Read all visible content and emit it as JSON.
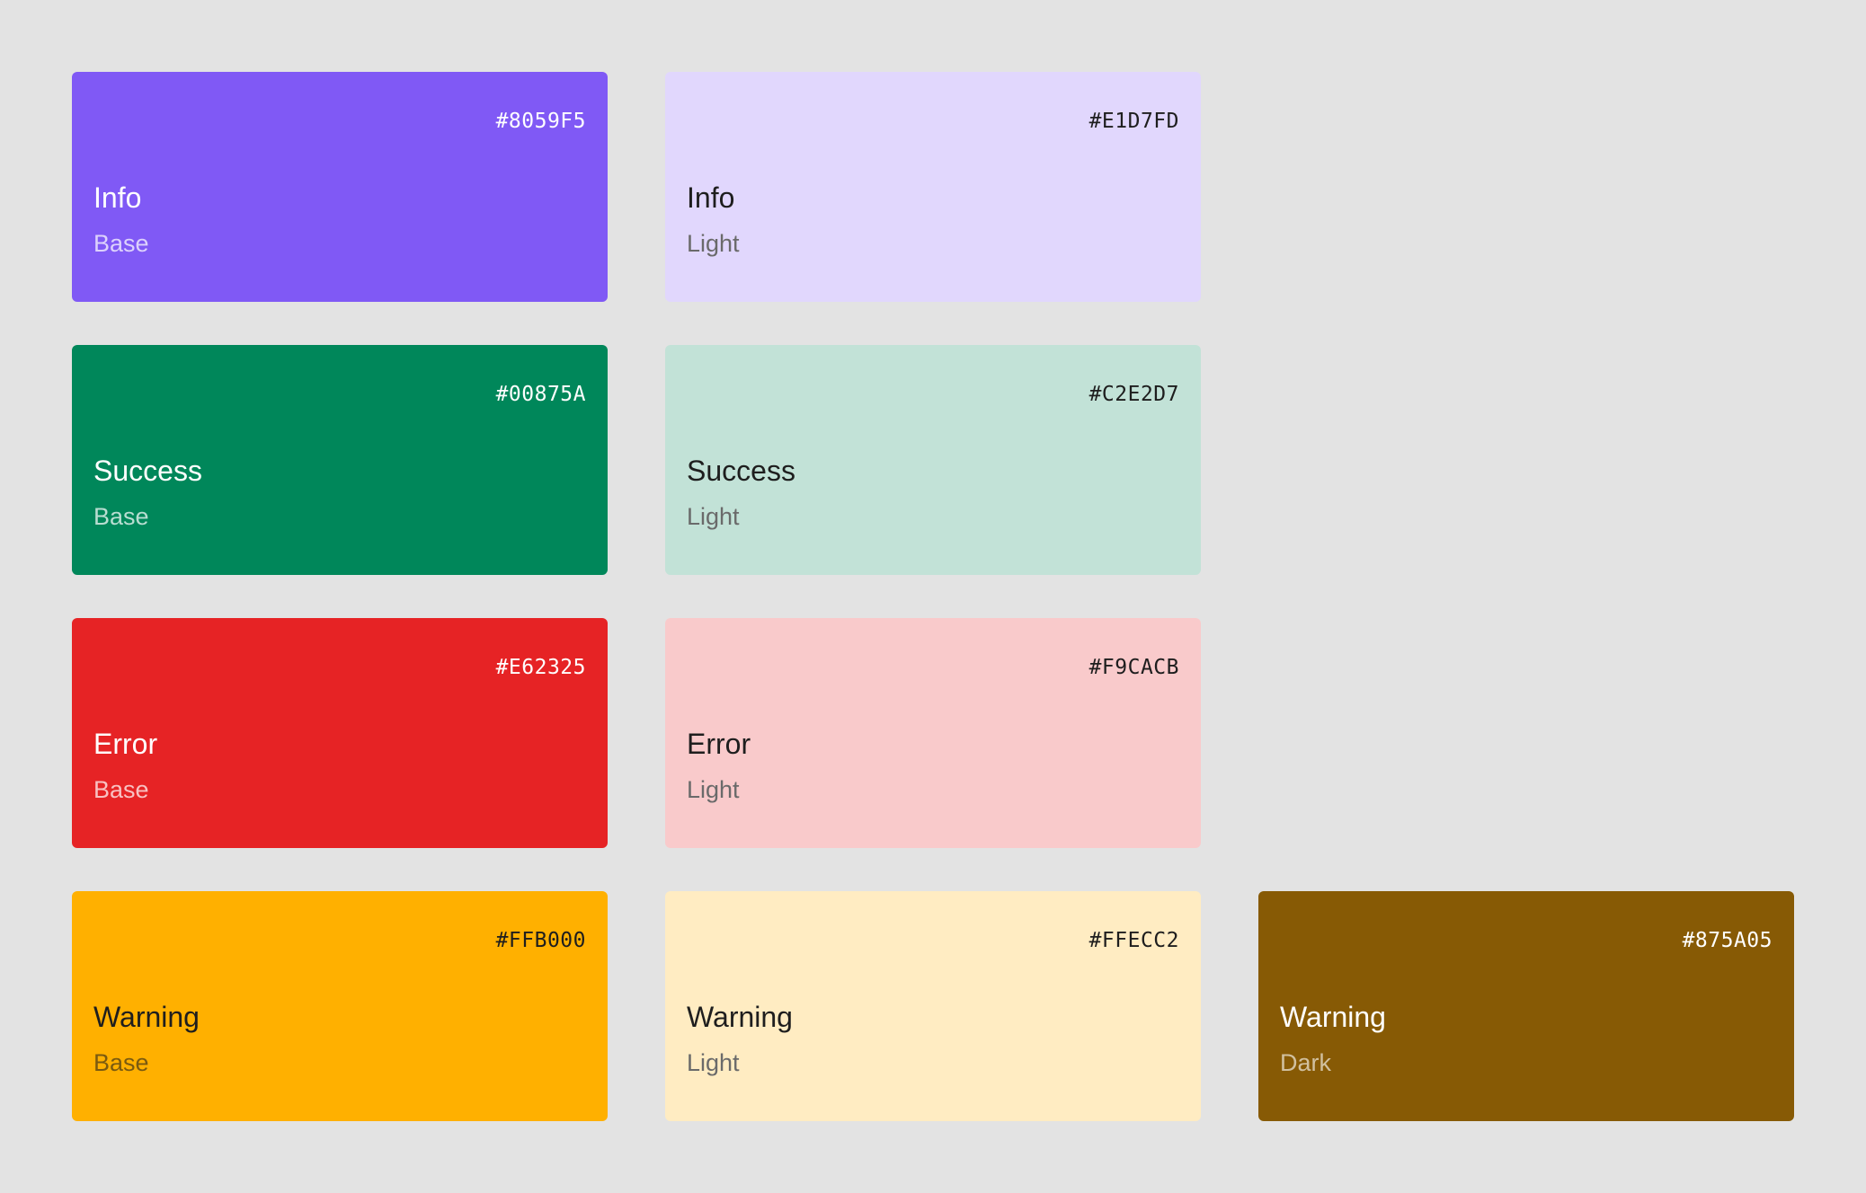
{
  "swatches": [
    {
      "name": "Info",
      "variant": "Base",
      "hex": "#8059F5",
      "bg": "#8059F5",
      "fg": "#FFFFFF",
      "sub": "rgba(255,255,255,0.72)",
      "col": 1,
      "row": 1
    },
    {
      "name": "Info",
      "variant": "Light",
      "hex": "#E1D7FD",
      "bg": "#E1D7FD",
      "fg": "#1E1E1E",
      "sub": "#6A6A6A",
      "col": 2,
      "row": 1
    },
    {
      "name": "Success",
      "variant": "Base",
      "hex": "#00875A",
      "bg": "#00875A",
      "fg": "#FFFFFF",
      "sub": "rgba(255,255,255,0.72)",
      "col": 1,
      "row": 2
    },
    {
      "name": "Success",
      "variant": "Light",
      "hex": "#C2E2D7",
      "bg": "#C2E2D7",
      "fg": "#1E1E1E",
      "sub": "#6A6A6A",
      "col": 2,
      "row": 2
    },
    {
      "name": "Error",
      "variant": "Base",
      "hex": "#E62325",
      "bg": "#E62325",
      "fg": "#FFFFFF",
      "sub": "rgba(255,255,255,0.72)",
      "col": 1,
      "row": 3
    },
    {
      "name": "Error",
      "variant": "Light",
      "hex": "#F9CACB",
      "bg": "#F9CACB",
      "fg": "#1E1E1E",
      "sub": "#6A6A6A",
      "col": 2,
      "row": 3
    },
    {
      "name": "Warning",
      "variant": "Base",
      "hex": "#FFB000",
      "bg": "#FFB000",
      "fg": "#1E1E1E",
      "sub": "#7A5A10",
      "col": 1,
      "row": 4
    },
    {
      "name": "Warning",
      "variant": "Light",
      "hex": "#FFECC2",
      "bg": "#FFECC2",
      "fg": "#1E1E1E",
      "sub": "#6A6A6A",
      "col": 2,
      "row": 4
    },
    {
      "name": "Warning",
      "variant": "Dark",
      "hex": "#875A05",
      "bg": "#875A05",
      "fg": "#FFFFFF",
      "sub": "rgba(255,255,255,0.62)",
      "col": 3,
      "row": 4
    }
  ]
}
